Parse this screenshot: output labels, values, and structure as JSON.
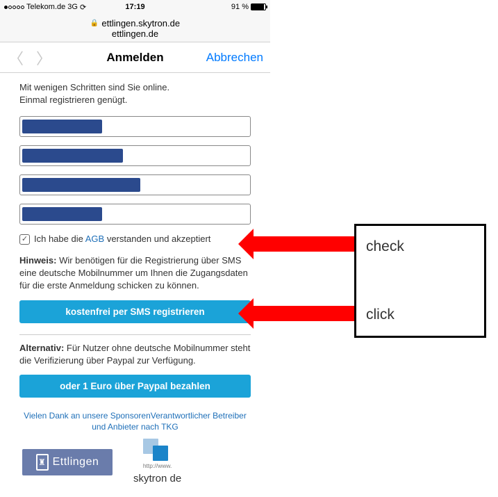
{
  "status": {
    "carrier": "Telekom.de",
    "net": "3G",
    "time": "17:19",
    "battery": "91 %"
  },
  "url": {
    "secure": "ettlingen.skytron.de",
    "sub": "ettlingen.de"
  },
  "nav": {
    "title": "Anmelden",
    "cancel": "Abbrechen"
  },
  "intro": {
    "l1": "Mit wenigen Schritten sind Sie online.",
    "l2": "Einmal registrieren genügt."
  },
  "agb": {
    "pre": "Ich habe die ",
    "link": "AGB",
    "post": " verstanden und akzeptiert"
  },
  "hinweis": {
    "label": "Hinweis:",
    "text": " Wir benötigen für die Registrierung über SMS eine deutsche Mobilnummer um Ihnen die Zugangsdaten für die erste Anmeldung schicken zu können."
  },
  "btn_sms": "kostenfrei per SMS registrieren",
  "alt": {
    "label": "Alternativ:",
    "text": " Für Nutzer ohne deutsche Mobilnummer steht die Verifizierung über Paypal zur Verfügung."
  },
  "btn_paypal": "oder 1 Euro über Paypal bezahlen",
  "footer": "Vielen Dank an unsere SponsorenVerantwortlicher Betreiber und Anbieter nach TKG",
  "sponsor1": "Ettlingen",
  "sponsor2": {
    "url": "http://www.",
    "name": "skytron de"
  },
  "anno": {
    "check": "check",
    "click": "click"
  }
}
